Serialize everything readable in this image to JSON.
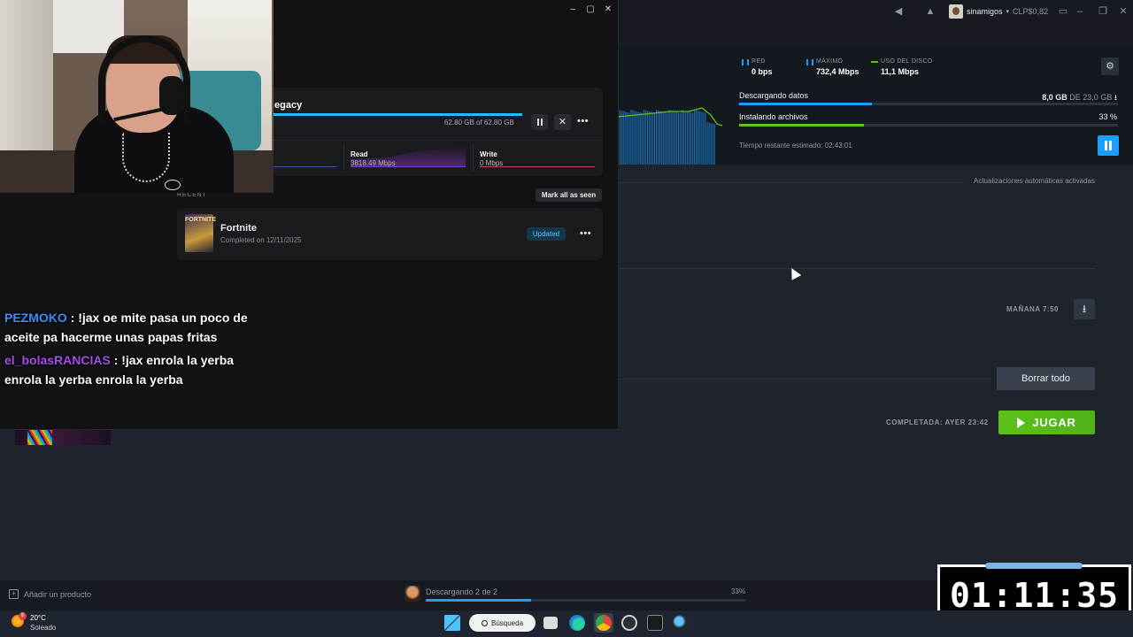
{
  "steam": {
    "topbar": {
      "username": "sinamigos",
      "balance": "CLP$0,82"
    },
    "downloads": {
      "stats": [
        {
          "label": "RED",
          "value": "0 bps",
          "color": "#1a9fff"
        },
        {
          "label": "MÁXIMO",
          "value": "732,4 Mbps",
          "color": "#1a9fff"
        },
        {
          "label": "USO DEL DISCO",
          "value": "11,1 Mbps",
          "color": "#5ec21a"
        }
      ],
      "downloading_label": "Descargando datos",
      "downloading_amount": "8,0 GB",
      "downloading_of": "DE 23,0 GB",
      "downloading_progress": 0.35,
      "installing_label": "Instalando archivos",
      "installing_pct": "33 %",
      "installing_progress": 0.33,
      "eta": "Tiempo restante estimado: 02:43:01",
      "auto_updates": "Actualizaciones automáticas activadas",
      "scheduled": "MAÑANA 7:50",
      "clear_all": "Borrar todo",
      "completed": "COMPLETADA: AYER 23:42",
      "play": "JUGAR"
    },
    "bottom": {
      "add_product": "Añadir un producto",
      "downloading_status": "Descargando 2 de 2",
      "downloading_pct": "33%",
      "progress": 0.33
    }
  },
  "epic": {
    "download": {
      "title": "egacy",
      "size": "62.80 GB of 62.80 GB",
      "progress": 1.0,
      "read_label": "Read",
      "read_value": "3818.49 Mbps",
      "write_label": "Write",
      "write_value": "0 Mbps"
    },
    "recent_label": "RECENT",
    "mark_all_seen": "Mark all as seen",
    "recent_item": {
      "thumb": "FORTNITE",
      "name": "Fortnite",
      "completed": "Completed on 12/11/2025",
      "status": "Updated"
    }
  },
  "chat": [
    {
      "user": "PEZMOKO",
      "user_color": "#3f8cff",
      "message": ": !jax oe mite pasa un poco de aceite pa hacerme unas papas fritas"
    },
    {
      "user": "el_bolasRANCIAS",
      "user_color": "#a64df0",
      "message": ": !jax enrola la yerba enrola la yerba enrola la yerba"
    }
  ],
  "timer": {
    "value": "01:11:35"
  },
  "taskbar": {
    "temperature": "20°C",
    "weather": "Soleado",
    "weather_badge": "8",
    "search": "Búsqueda"
  }
}
